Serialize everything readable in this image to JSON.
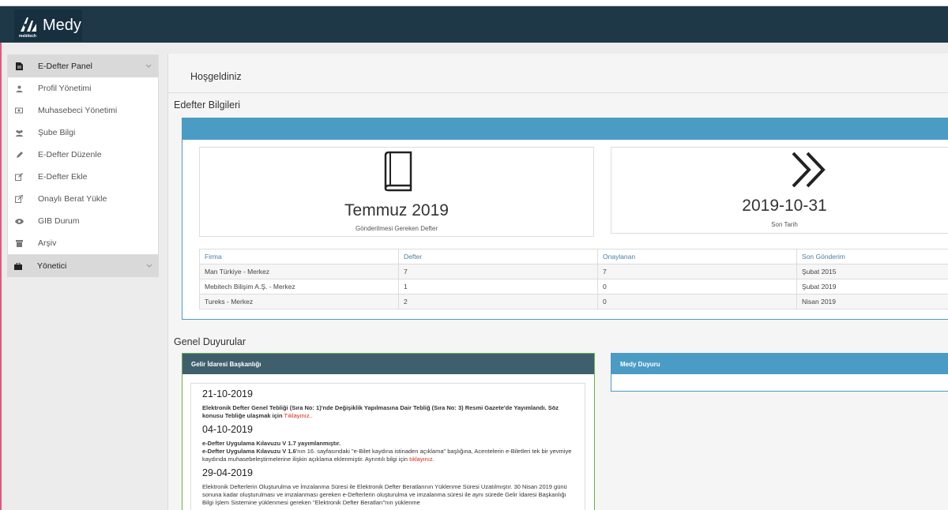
{
  "brand": {
    "name": "Medy",
    "sub": "mebitech"
  },
  "sidebar": {
    "items": [
      {
        "label": "E-Defter Panel",
        "icon": "file-icon",
        "head": true
      },
      {
        "label": "Profil Yönetimi",
        "icon": "user-icon"
      },
      {
        "label": "Muhasebeci Yönetimi",
        "icon": "money-icon"
      },
      {
        "label": "Şube Bilgi",
        "icon": "users-icon"
      },
      {
        "label": "E-Defter Düzenle",
        "icon": "pencil-icon"
      },
      {
        "label": "E-Defter Ekle",
        "icon": "edit-icon"
      },
      {
        "label": "Onaylı Berat Yükle",
        "icon": "external-link-icon"
      },
      {
        "label": "GIB Durum",
        "icon": "eye-icon"
      },
      {
        "label": "Arşiv",
        "icon": "archive-icon"
      }
    ],
    "admin": {
      "label": "Yönetici",
      "icon": "briefcase-icon"
    }
  },
  "main": {
    "welcome": "Hoşgeldiniz",
    "edefter_title": "Edefter Bilgileri",
    "stat1": {
      "value": "Temmuz 2019",
      "caption": "Gönderilmesi Gereken Defter"
    },
    "stat2": {
      "value": "2019-10-31",
      "caption": "Son Tarih"
    },
    "table": {
      "headers": [
        "Firma",
        "Defter",
        "Onaylanan",
        "Son Gönderim"
      ],
      "rows": [
        [
          "Man Türkiye - Merkez",
          "7",
          "7",
          "Şubat 2015"
        ],
        [
          "Mebitech Bilişim A.Ş. - Merkez",
          "1",
          "0",
          "Şubat 2019"
        ],
        [
          "Tureks - Merkez",
          "2",
          "0",
          "Nisan 2019"
        ]
      ]
    },
    "announcements_title": "Genel Duyurular",
    "gib_panel": {
      "title": "Gelir İdaresi Başkanlığı",
      "entries": [
        {
          "date": "21-10-2019",
          "text": "Elektronik Defter Genel Tebliği (Sıra No: 1)'nde Değişiklik Yapılmasına Dair Tebliğ (Sıra No: 3) Resmi Gazete'de Yayımlandı. Söz konusu Tebliğe ulaşmak için",
          "link": "Tıklayınız.."
        },
        {
          "date": "04-10-2019",
          "line1": "e-Defter Uygulama Kılavuzu V 1.7 yayımlanmıştır.",
          "line2_bold": "e-Defter Uygulama Kılavuzu V 1.6",
          "line2_rest": "'nın 16. sayfasındaki \"e-Bilet kaydına istinaden açıklama\" başlığına, Acentelerin e-Biletleri tek bir yevmiye kaydında muhasebeleştirmelerine ilişkin açıklama eklenmiştir. Ayrıntılı bilgi için",
          "link": "tıklayınız."
        },
        {
          "date": "29-04-2019",
          "text": "Elektronik Defterlerin Oluşturulma ve İmzalanma Süresi ile Elektronik Defter Beratlarının Yüklenme Süresi Uzatılmıştır. 30 Nisan 2019 günü sonuna kadar oluşturulması ve imzalanması gereken e-Defterlerin oluşturulma ve imzalanma süresi ile aynı sürede Gelir İdaresi Başkanlığı Bilgi İşlem Sistemine yüklenmesi gereken \"Elektronik Defter Beratları\"nın yüklenme"
        }
      ]
    },
    "medy_panel": {
      "title": "Medy Duyuru"
    }
  },
  "colors": {
    "navbar": "#1e3848",
    "panel_blue": "#4b9cc5",
    "gib_green": "#6ab04c",
    "link_red": "#d9230f"
  }
}
